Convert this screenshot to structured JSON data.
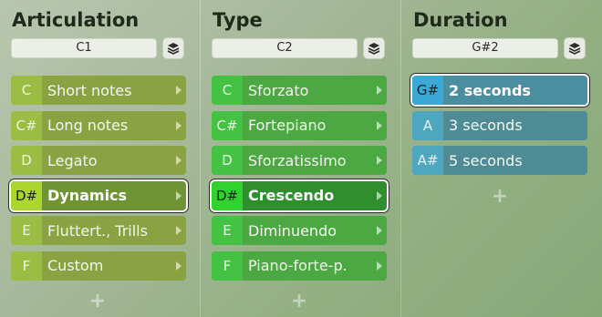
{
  "columns": [
    {
      "title": "Articulation",
      "map_value": "C1",
      "add_label": "+",
      "items": [
        {
          "key": "C",
          "label": "Short notes"
        },
        {
          "key": "C#",
          "label": "Long notes"
        },
        {
          "key": "D",
          "label": "Legato"
        },
        {
          "key": "D#",
          "label": "Dynamics",
          "selected": true
        },
        {
          "key": "E",
          "label": "Fluttert., Trills"
        },
        {
          "key": "F",
          "label": "Custom"
        }
      ]
    },
    {
      "title": "Type",
      "map_value": "C2",
      "add_label": "+",
      "items": [
        {
          "key": "C",
          "label": "Sforzato"
        },
        {
          "key": "C#",
          "label": "Fortepiano"
        },
        {
          "key": "D",
          "label": "Sforzatissimo"
        },
        {
          "key": "D#",
          "label": "Crescendo",
          "selected": true
        },
        {
          "key": "E",
          "label": "Diminuendo"
        },
        {
          "key": "F",
          "label": "Piano-forte-p."
        }
      ]
    },
    {
      "title": "Duration",
      "map_value": "G#2",
      "add_label": "+",
      "items": [
        {
          "key": "G#",
          "label": "2 seconds",
          "selected": true
        },
        {
          "key": "A",
          "label": "3 seconds"
        },
        {
          "key": "A#",
          "label": "5 seconds"
        }
      ]
    }
  ],
  "icons": {
    "layers": "layers-icon",
    "submenu": "chevron-right-icon",
    "add": "plus-icon"
  },
  "colors": {
    "articulation_accent": "#aad62f",
    "type_accent": "#31d22e",
    "duration_accent": "#3aa9d6"
  }
}
